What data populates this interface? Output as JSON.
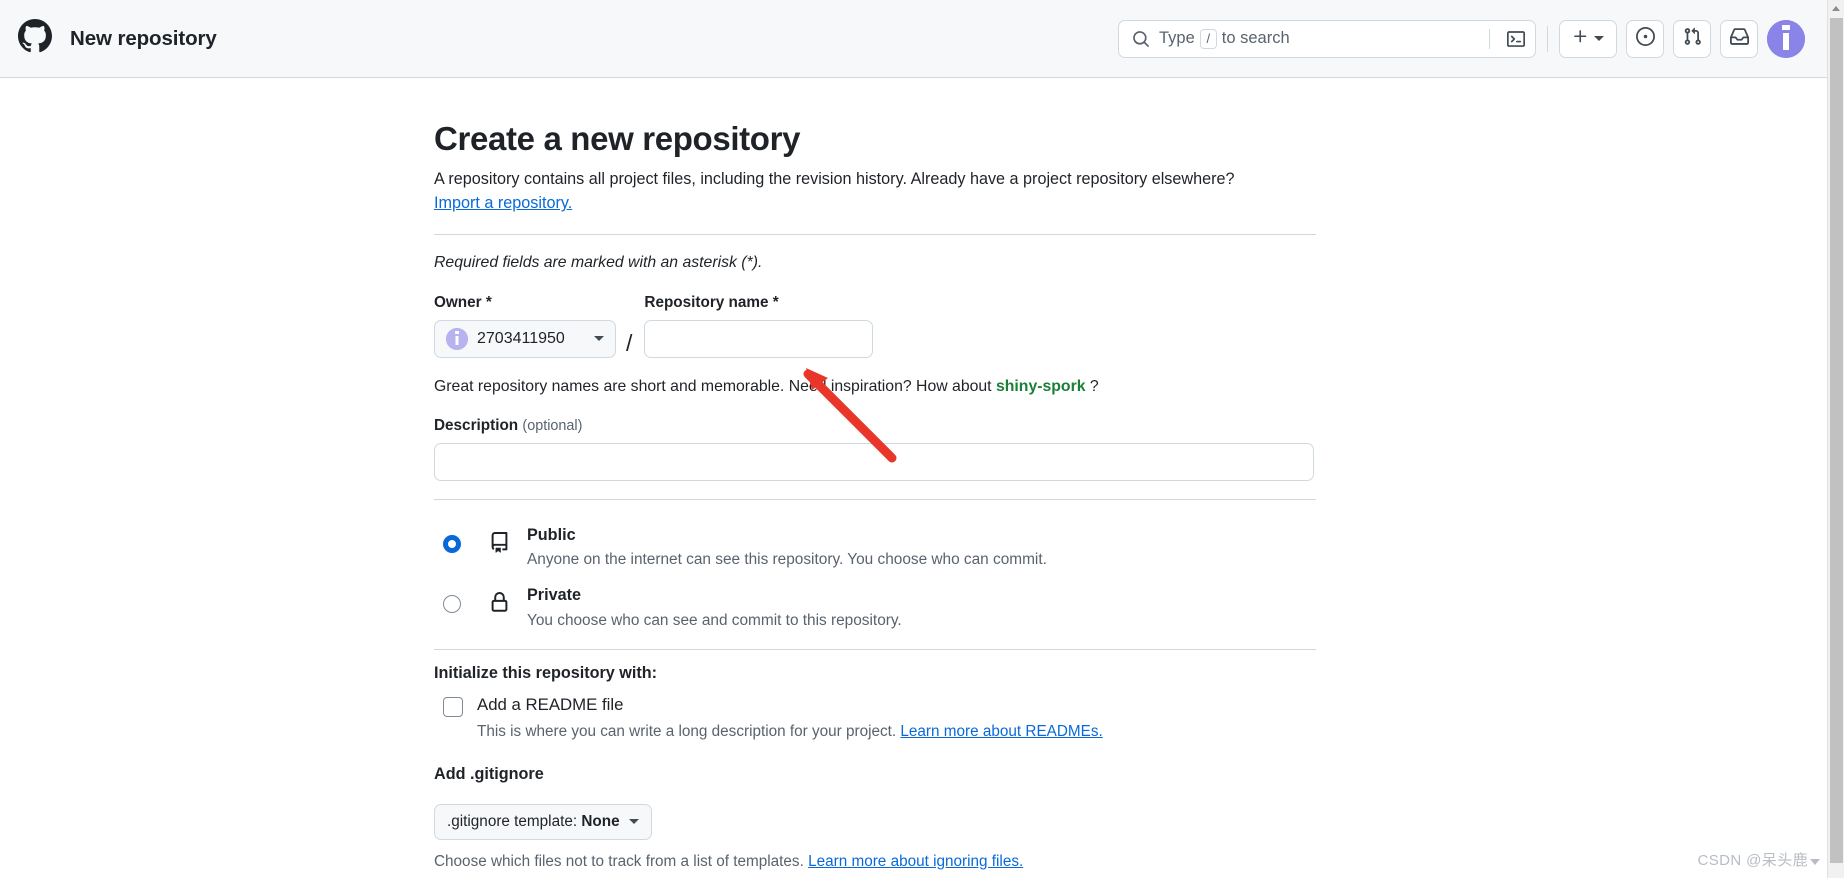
{
  "header": {
    "logo_icon": "github-mark-icon",
    "title": "New repository",
    "search": {
      "placeholder": "Type",
      "slash_key": "/",
      "placeholder_tail": "to search",
      "icon": "search-icon",
      "terminal_icon": "terminal-icon"
    },
    "actions": {
      "create_new_label": "+",
      "create_new_icon": "plus-icon",
      "issues_icon": "issue-opened-icon",
      "pull_requests_icon": "git-pull-request-icon",
      "inbox_icon": "inbox-icon",
      "avatar_icon": "user-avatar-icon"
    }
  },
  "main": {
    "title": "Create a new repository",
    "lede": "A repository contains all project files, including the revision history. Already have a project repository elsewhere?",
    "import_link": "Import a repository.",
    "required_note": "Required fields are marked with an asterisk (*).",
    "owner": {
      "label": "Owner *",
      "value": "2703411950",
      "avatar_icon": "owner-avatar-icon",
      "caret_icon": "chevron-down-icon"
    },
    "separator": "/",
    "repo_name": {
      "label": "Repository name *",
      "value": "",
      "placeholder": ""
    },
    "hint_prefix": "Great repository names are short and memorable. Need inspiration? How about",
    "hint_suggestion": "shiny-spork",
    "hint_suffix": "?",
    "description": {
      "label": "Description",
      "optional": "(optional)",
      "value": "",
      "placeholder": ""
    },
    "visibility": [
      {
        "id": "public",
        "title": "Public",
        "description": "Anyone on the internet can see this repository. You choose who can commit.",
        "icon": "repo-book-icon",
        "selected": true
      },
      {
        "id": "private",
        "title": "Private",
        "description": "You choose who can see and commit to this repository.",
        "icon": "lock-icon",
        "selected": false
      }
    ],
    "initialize": {
      "heading": "Initialize this repository with:",
      "readme": {
        "label": "Add a README file",
        "description": "This is where you can write a long description for your project.",
        "link": "Learn more about READMEs.",
        "checked": false
      }
    },
    "gitignore": {
      "heading": "Add .gitignore",
      "select_prefix": ".gitignore template:",
      "select_value": "None",
      "caret_icon": "chevron-down-icon",
      "footer_prefix": "Choose which files not to track from a list of templates.",
      "footer_link": "Learn more about ignoring files."
    }
  },
  "annotation": {
    "arrow_color": "#e8362a",
    "arrow_icon": "red-arrow-annotation"
  },
  "watermark": {
    "text": "CSDN @呆头鹿"
  },
  "colors": {
    "accent_blue": "#0969da",
    "success_green": "#1a7f37",
    "header_bg": "#f6f8fa",
    "border": "#d1d9e0",
    "text": "#1f2328",
    "muted_text": "#59636e"
  }
}
